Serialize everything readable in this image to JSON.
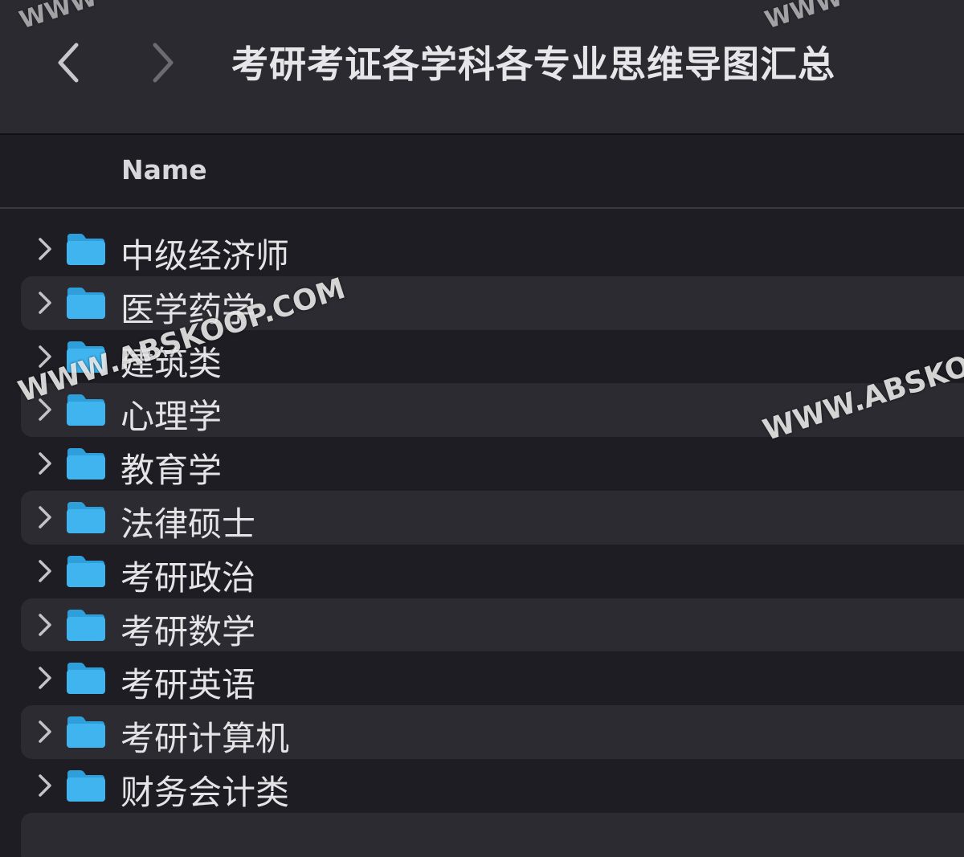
{
  "window": {
    "title": "考研考证各学科各专业思维导图汇总"
  },
  "toolbar": {
    "back_icon": "chevron-left-icon",
    "forward_icon": "chevron-right-icon"
  },
  "columns": {
    "name_header": "Name"
  },
  "files": [
    {
      "name": "中级经济师",
      "kind": "folder"
    },
    {
      "name": "医学药学",
      "kind": "folder"
    },
    {
      "name": "建筑类",
      "kind": "folder"
    },
    {
      "name": "心理学",
      "kind": "folder"
    },
    {
      "name": "教育学",
      "kind": "folder"
    },
    {
      "name": "法律硕士",
      "kind": "folder"
    },
    {
      "name": "考研政治",
      "kind": "folder"
    },
    {
      "name": "考研数学",
      "kind": "folder"
    },
    {
      "name": "考研英语",
      "kind": "folder"
    },
    {
      "name": "考研计算机",
      "kind": "folder"
    },
    {
      "name": "财务会计类",
      "kind": "folder"
    }
  ],
  "watermarks": {
    "main": "WWW.ABSKOOP.COM",
    "right": "WWW.ABSKO",
    "top_left": "WWW",
    "top_right": "WWW"
  },
  "colors": {
    "folder": "#3fb4ee",
    "folder_tab": "#2f9fdc",
    "background": "#1e1d23",
    "alt_row": "#2c2b31",
    "titlebar": "#2b2a30"
  }
}
